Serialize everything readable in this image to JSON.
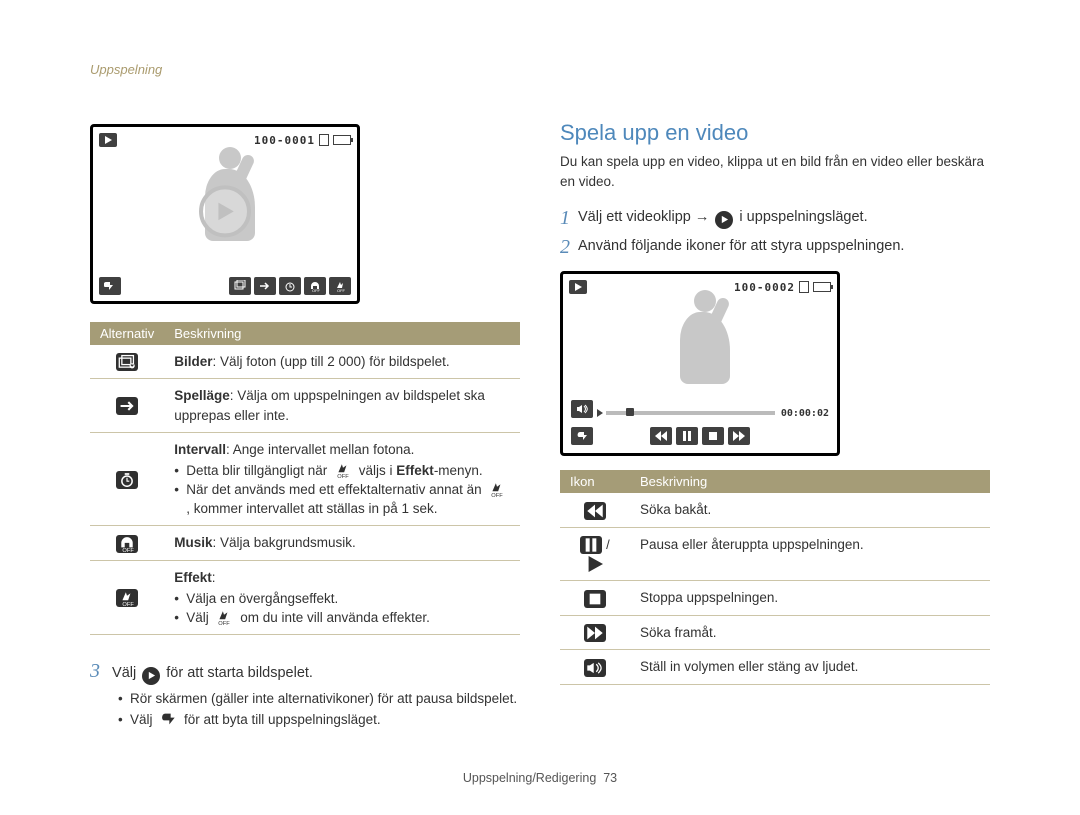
{
  "breadcrumb": "Uppspelning",
  "left": {
    "lcd_file": "100-0001",
    "table": {
      "head": {
        "col1": "Alternativ",
        "col2": "Beskrivning"
      },
      "rows": {
        "images": {
          "strong": "Bilder",
          "rest": ": Välj foton (upp till 2 000) för bildspelet."
        },
        "playmode": {
          "strong": "Spelläge",
          "rest": ": Välja om uppspelningen av bildspelet ska upprepas eller inte."
        },
        "interval": {
          "strong": "Intervall",
          "rest": ": Ange intervallet mellan fotona.",
          "b1a": "Detta blir tillgängligt när ",
          "b1b": " väljs i ",
          "b1_strong": "Effekt",
          "b1c": "-menyn.",
          "b2a": "När det används med ett effektalternativ annat än ",
          "b2b": ", kommer intervallet att ställas in på 1 sek."
        },
        "music": {
          "strong": "Musik",
          "rest": ": Välja bakgrundsmusik."
        },
        "effect": {
          "strong": "Effekt",
          "rest": ":",
          "b1": "Välja en övergångseffekt.",
          "b2a": "Välj ",
          "b2b": " om du inte vill använda effekter."
        }
      }
    },
    "step3": {
      "num": "3",
      "a": "Välj ",
      "b": " för att starta bildspelet.",
      "sub1": "Rör skärmen (gäller inte alternativikoner) för att pausa bildspelet.",
      "sub2a": "Välj ",
      "sub2b": " för att byta till uppspelningsläget."
    }
  },
  "right": {
    "title": "Spela upp en video",
    "intro": "Du kan spela upp en video, klippa ut en bild från en video eller beskära en video.",
    "step1": {
      "num": "1",
      "a": "Välj ett videoklipp → ",
      "b": " i uppspelningsläget."
    },
    "step2": {
      "num": "2",
      "text": "Använd följande ikoner för att styra uppspelningen."
    },
    "lcd_file": "100-0002",
    "lcd_time": "00:00:02",
    "table": {
      "head": {
        "col1": "Ikon",
        "col2": "Beskrivning"
      },
      "rows": {
        "rew": "Söka bakåt.",
        "pause": "Pausa eller återuppta uppspelningen.",
        "stop": "Stoppa uppspelningen.",
        "fwd": "Söka framåt.",
        "vol": "Ställ in volymen eller stäng av ljudet."
      }
    }
  },
  "footer": {
    "label": "Uppspelning/Redigering",
    "page": "73"
  }
}
